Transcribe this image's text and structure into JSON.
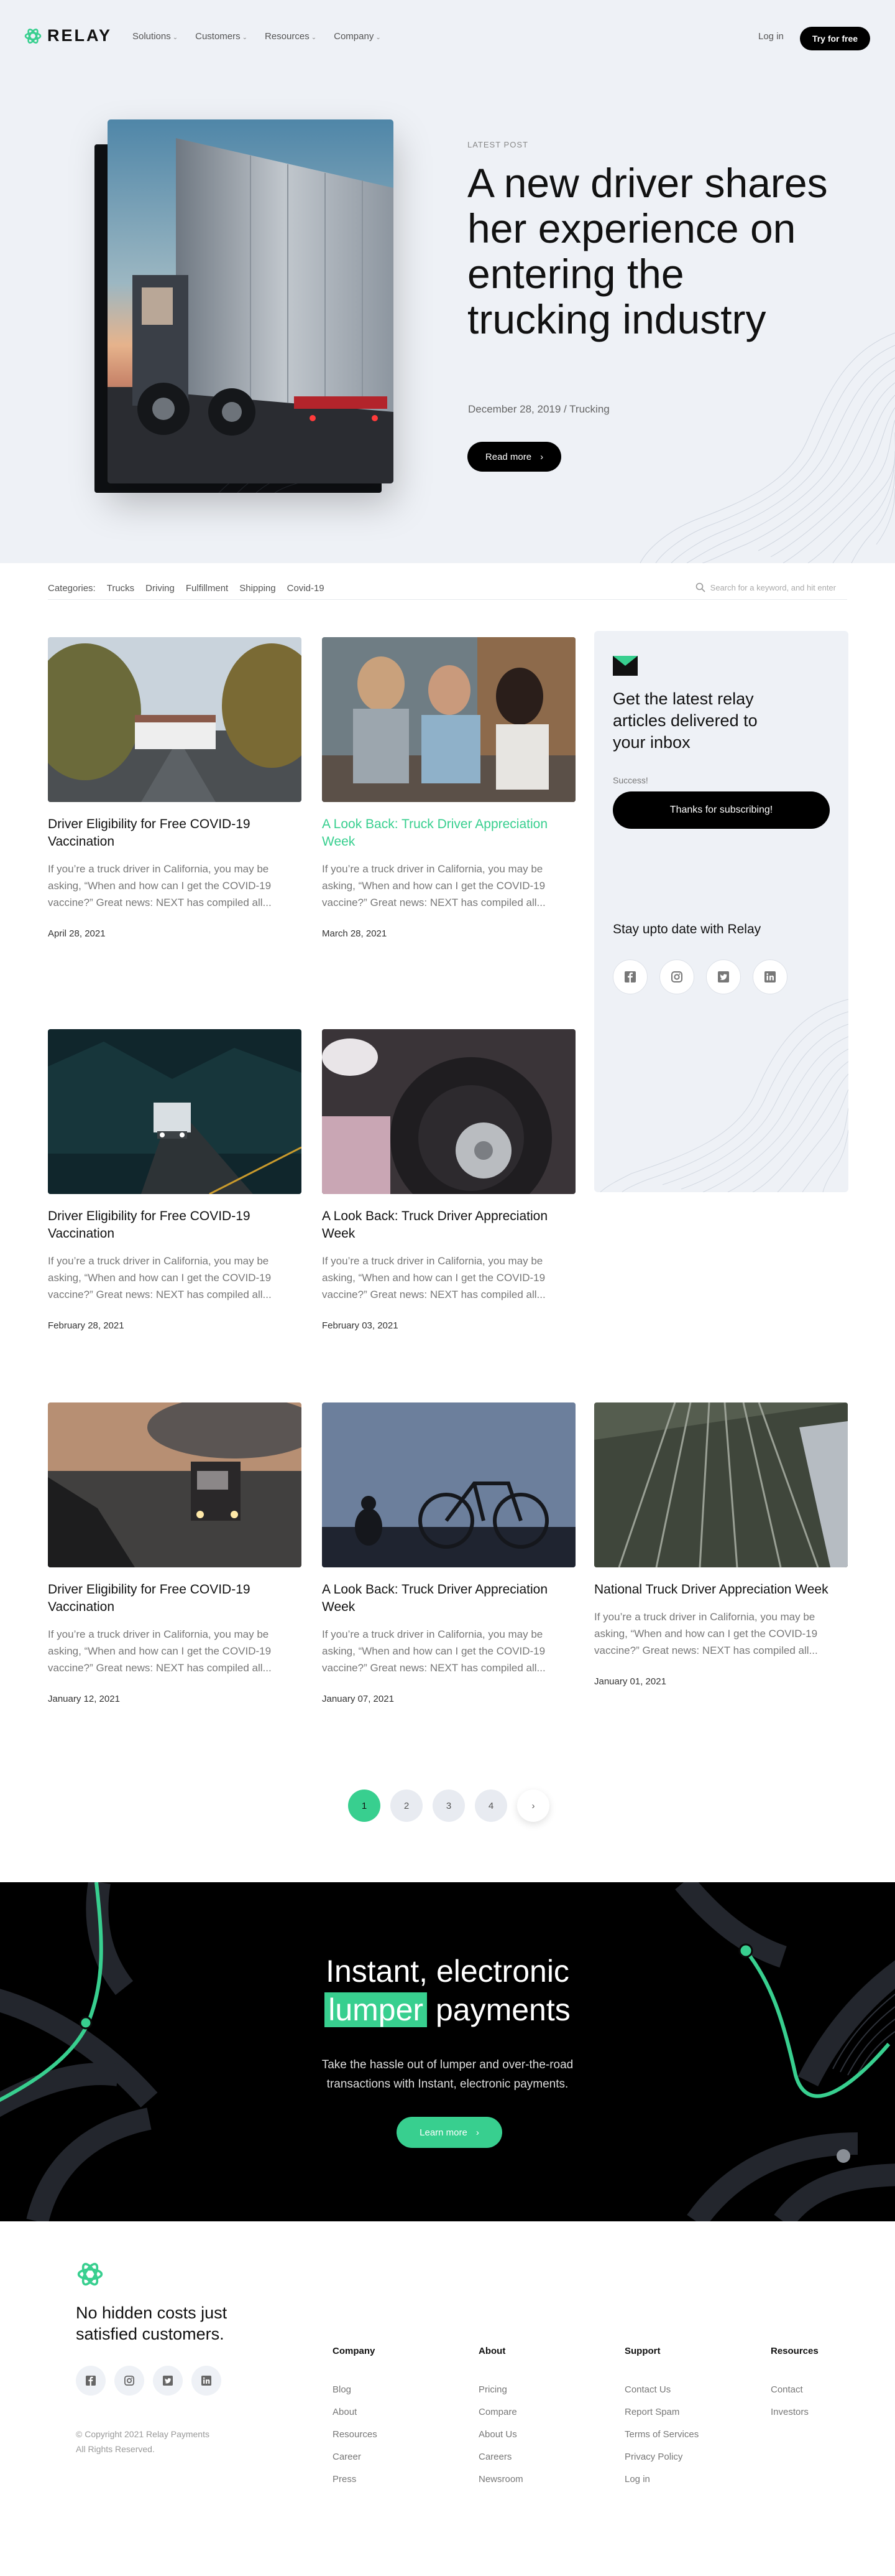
{
  "brand": {
    "name": "RELAY",
    "accent": "#38cf8f"
  },
  "nav": {
    "items": [
      "Solutions",
      "Customers",
      "Resources",
      "Company"
    ],
    "login": "Log in",
    "cta": "Try for free"
  },
  "hero": {
    "eyebrow": "LATEST POST",
    "title": "A new driver shares her experience on entering the trucking industry",
    "meta": "December 28, 2019 / Trucking",
    "button": "Read more"
  },
  "categories": {
    "label": "Categories:",
    "items": [
      "Trucks",
      "Driving",
      "Fulfillment",
      "Shipping",
      "Covid-19"
    ],
    "search_placeholder": "Search for a keyword, and hit enter"
  },
  "posts": [
    {
      "title": "Driver Eligibility for Free COVID-19 Vaccination",
      "excerpt": "If you’re a truck driver in California, you may be asking, “When and how can I get the COVID-19 vaccine?” Great news: NEXT has compiled all...",
      "date": "April 28, 2021"
    },
    {
      "title": "A Look Back: Truck Driver Appreciation Week",
      "excerpt": "If you’re a truck driver in California, you may be asking, “When and how can I get the COVID-19 vaccine?” Great news: NEXT has compiled all...",
      "date": "March 28, 2021"
    },
    {
      "title": "Driver Eligibility for Free COVID-19 Vaccination",
      "excerpt": "If you’re a truck driver in California, you may be asking, “When and how can I get the COVID-19 vaccine?” Great news: NEXT has compiled all...",
      "date": "February 28, 2021"
    },
    {
      "title": "A Look Back: Truck Driver Appreciation Week",
      "excerpt": "If you’re a truck driver in California, you may be asking, “When and how can I get the COVID-19 vaccine?” Great news: NEXT has compiled all...",
      "date": "February 03, 2021"
    },
    {
      "title": "Driver Eligibility for Free COVID-19 Vaccination",
      "excerpt": "If you’re a truck driver in California, you may be asking, “When and how can I get the COVID-19 vaccine?” Great news: NEXT has compiled all...",
      "date": "January 12, 2021"
    },
    {
      "title": "A Look Back: Truck Driver Appreciation Week",
      "excerpt": "If you’re a truck driver in California, you may be asking, “When and how can I get the COVID-19 vaccine?” Great news: NEXT has compiled all...",
      "date": "January 07, 2021"
    },
    {
      "title": "National Truck Driver Appreciation Week",
      "excerpt": "If you’re a truck driver in California, you may be asking, “When and how can I get the COVID-19 vaccine?” Great news: NEXT has compiled all...",
      "date": "January 01, 2021"
    }
  ],
  "subscribe": {
    "title": "Get the latest relay articles delivered to your inbox",
    "success": "Success!",
    "button": "Thanks for subscribing!",
    "stay": "Stay upto date with Relay"
  },
  "pagination": {
    "pages": [
      "1",
      "2",
      "3",
      "4"
    ],
    "current": "1"
  },
  "cta": {
    "title_1": "Instant, electronic",
    "highlight": "lumper",
    "title_2": "payments",
    "text": "Take the hassle out of lumper and over-the-road transactions with Instant, electronic payments.",
    "button": "Learn more"
  },
  "footer": {
    "tagline": "No hidden costs just satisfied customers.",
    "copyright_1": "© Copyright 2021 Relay Payments",
    "copyright_2": "All Rights Reserved.",
    "columns": [
      {
        "heading": "Company",
        "links": [
          "Blog",
          "About",
          "Resources",
          "Career",
          "Press"
        ]
      },
      {
        "heading": "About",
        "links": [
          "Pricing",
          "Compare",
          "About Us",
          "Careers",
          "Newsroom"
        ]
      },
      {
        "heading": "Support",
        "links": [
          "Contact Us",
          "Report Spam",
          "Terms of Services",
          "Privacy Policy",
          "Log in"
        ]
      },
      {
        "heading": "Resources",
        "links": [
          "Contact",
          "Investors"
        ]
      }
    ]
  },
  "icons": [
    "relay-logo-icon",
    "chevron-down-icon",
    "search-icon",
    "mail-icon",
    "facebook-icon",
    "instagram-icon",
    "twitter-icon",
    "linkedin-icon",
    "arrow-right-icon"
  ]
}
